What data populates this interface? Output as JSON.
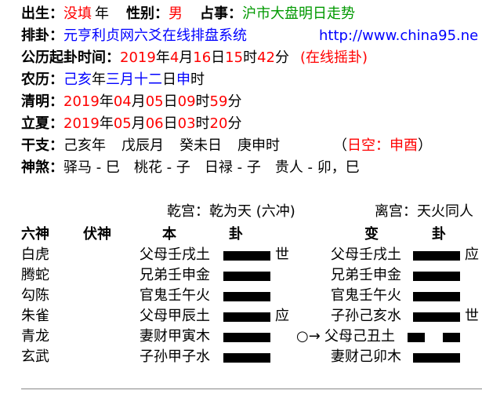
{
  "header": {
    "birth_label": "出生：",
    "birth_value": "没填",
    "year_unit": "年",
    "gender_label": "性别：",
    "gender_value": "男",
    "matter_label": "占事：",
    "matter_value": "沪市大盘明日走势",
    "paigua_label": "排卦：",
    "paigua_site": "元亨利贞网六爻在线排盘系统",
    "paigua_url": "http://www.china95.ne",
    "time_label": "公历起卦时间：",
    "time_year": "2019",
    "time_year_unit": "年",
    "time_month": "4",
    "time_month_unit": "月",
    "time_day": "16",
    "time_day_unit": "日",
    "time_hour": "15",
    "time_hour_unit": "时",
    "time_min": "42",
    "time_min_unit": "分",
    "time_mode": "(在线摇卦)",
    "lunar_label": "农历：",
    "lunar_year": "己亥",
    "lunar_year_unit": "年",
    "lunar_month": "三月",
    "lunar_day": "十二",
    "lunar_day_unit": "日",
    "lunar_hour": "申",
    "lunar_hour_unit": "时",
    "qingming_label": "清明：",
    "qingming_year": "2019",
    "qingming_month": "04",
    "qingming_day": "05",
    "qingming_hour": "09",
    "qingming_min": "59",
    "lixia_label": "立夏：",
    "lixia_year": "2019",
    "lixia_month": "05",
    "lixia_day": "06",
    "lixia_hour": "03",
    "lixia_min": "20",
    "unit_year": "年",
    "unit_month": "月",
    "unit_day": "日",
    "unit_hour": "时",
    "unit_min": "分",
    "ganzhi_label": "干支：",
    "ganzhi_year": "己亥年",
    "ganzhi_month": "戊辰月",
    "ganzhi_day": "癸未日",
    "ganzhi_hour": "庚申时",
    "kong_open": "（",
    "kong_text": "日空：申酉",
    "kong_close": "）",
    "shensha_label": "神煞：",
    "shensha_text": "驿马 - 巳　桃花 - 子　日禄 - 子　贵人 - 卯，巳"
  },
  "gua": {
    "main_palace": "乾宫：乾为天 (六冲)",
    "change_palace": "离宫：天火同人",
    "col_liushen": "六神",
    "col_fushen": "伏神",
    "col_ben": "本",
    "col_gua1": "卦",
    "col_bian": "变",
    "col_gua2": "卦",
    "rows": [
      {
        "shen": "白虎",
        "ben": "父母壬戌土",
        "mark": "世",
        "bian": "父母壬戌土",
        "bmark": "应",
        "ben_yin": false,
        "bian_yin": false
      },
      {
        "shen": "腾蛇",
        "ben": "兄弟壬申金",
        "mark": "",
        "bian": "兄弟壬申金",
        "bmark": "",
        "ben_yin": false,
        "bian_yin": false
      },
      {
        "shen": "勾陈",
        "ben": "官鬼壬午火",
        "mark": "",
        "bian": "官鬼壬午火",
        "bmark": "",
        "ben_yin": false,
        "bian_yin": false
      },
      {
        "shen": "朱雀",
        "ben": "父母甲辰土",
        "mark": "应",
        "bian": "子孙己亥水",
        "bmark": "世",
        "ben_yin": false,
        "bian_yin": false
      },
      {
        "shen": "青龙",
        "ben": "妻财甲寅木",
        "mark": "",
        "moving": "○→",
        "bian": "父母己丑土",
        "bmark": "",
        "ben_yin": false,
        "bian_yin": true
      },
      {
        "shen": "玄武",
        "ben": "子孙甲子水",
        "mark": "",
        "bian": "妻财己卯木",
        "bmark": "",
        "ben_yin": false,
        "bian_yin": false
      }
    ]
  }
}
